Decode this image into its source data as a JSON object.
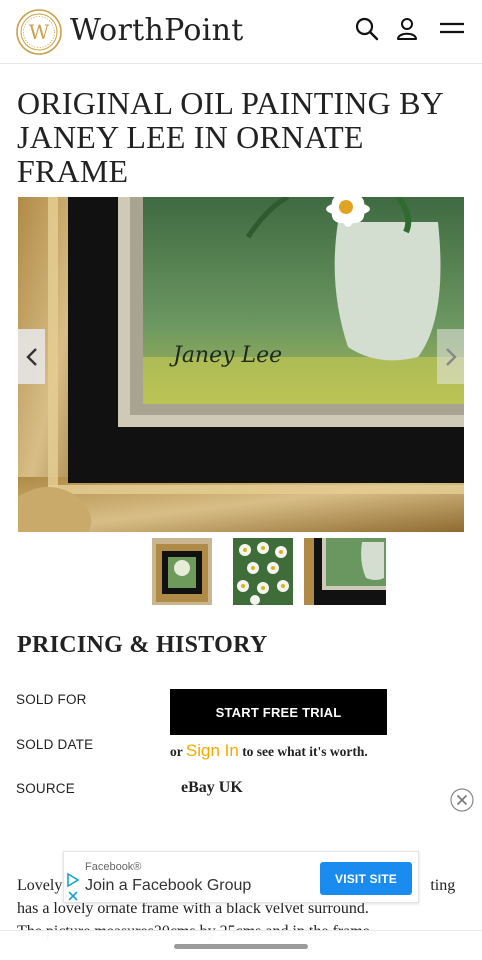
{
  "header": {
    "logo_letter": "W",
    "brand_name": "WorthPoint",
    "icons": [
      "search-icon",
      "user-icon",
      "hamburger-menu-icon"
    ]
  },
  "item": {
    "title": "ORIGINAL OIL PAINTING BY JANEY LEE IN ORNATE FRAME",
    "image_signature": "Janey Lee",
    "thumbnail_count": 3
  },
  "pricing": {
    "section_title": "PRICING & HISTORY",
    "sold_for_label": "SOLD FOR",
    "sold_date_label": "SOLD DATE",
    "source_label": "SOURCE",
    "trial_button": "START FREE TRIAL",
    "signin_prefix": "or",
    "signin_link": "Sign In",
    "signin_suffix": "to see what it's worth.",
    "source_value": "eBay UK"
  },
  "description": {
    "line1_start": "Lovely",
    "line1_end": "ting",
    "line2": "has a lovely ornate frame with a black velvet surround.",
    "line3": "The picture measures20cms by 25cms and in the frame"
  },
  "ad": {
    "source": "Facebook®",
    "headline": "Join a Facebook Group",
    "cta": "VISIT SITE"
  },
  "colors": {
    "accent_gold": "#f2a900",
    "button_black": "#000000",
    "ad_blue": "#1a8cf0"
  }
}
